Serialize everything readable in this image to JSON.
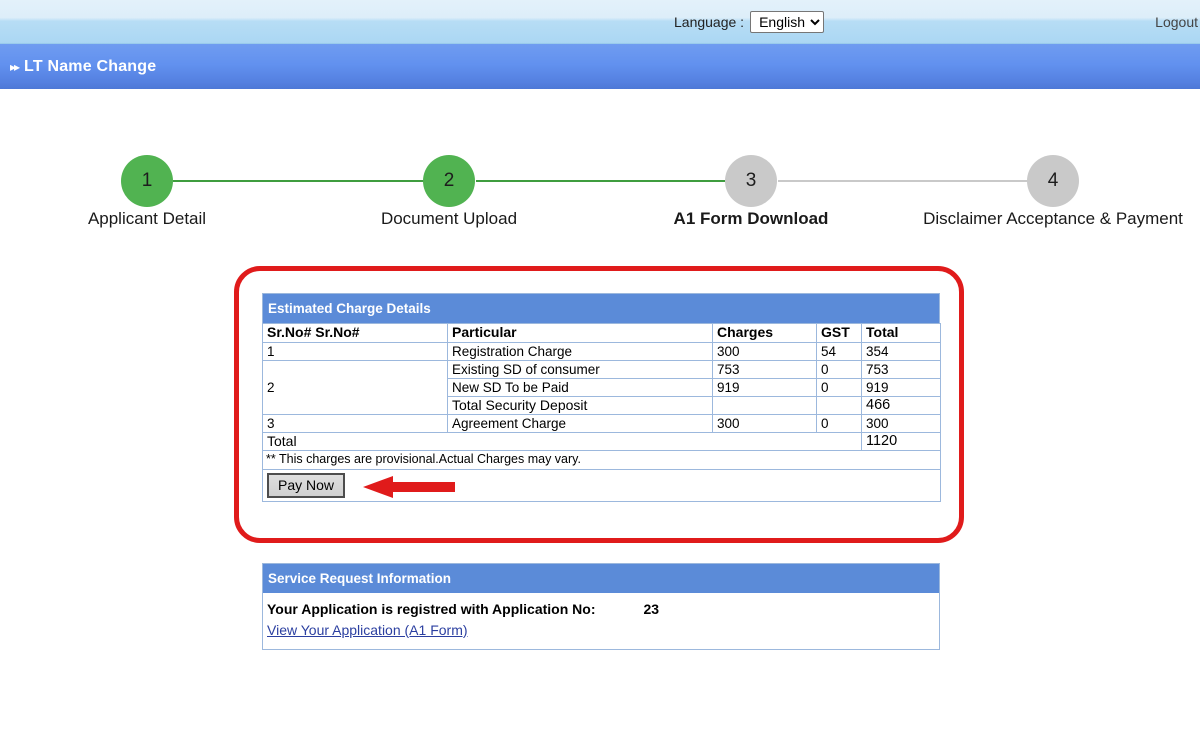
{
  "topbar": {
    "language_label": "Language :",
    "language_value": "English",
    "language_options": [
      "English"
    ],
    "logout_label": "Logout"
  },
  "header": {
    "bullet": "▸▸",
    "title": "LT Name Change"
  },
  "stepper": {
    "steps": [
      {
        "number": "1",
        "label": "Applicant Detail",
        "state": "done"
      },
      {
        "number": "2",
        "label": "Document Upload",
        "state": "done"
      },
      {
        "number": "3",
        "label": "A1 Form Download",
        "state": "active"
      },
      {
        "number": "4",
        "label": "Disclaimer Acceptance & Payment",
        "state": "todo"
      }
    ]
  },
  "charges_panel": {
    "title": "Estimated Charge Details",
    "columns": [
      "Sr.No# Sr.No#",
      "Particular",
      "Charges",
      "GST",
      "Total"
    ],
    "rows": [
      {
        "sr": "1",
        "particular": "Registration Charge",
        "charges": "300",
        "gst": "54",
        "total": "354"
      },
      {
        "sr": "2",
        "particular": "Existing SD of consumer",
        "charges": "753",
        "gst": "0",
        "total": "753"
      },
      {
        "sr": "",
        "particular": "New SD To be Paid",
        "charges": "919",
        "gst": "0",
        "total": "919"
      },
      {
        "sr": "",
        "particular": "Total Security Deposit",
        "charges": "",
        "gst": "",
        "total": "466"
      },
      {
        "sr": "3",
        "particular": "Agreement Charge",
        "charges": "300",
        "gst": "0",
        "total": "300"
      }
    ],
    "total_label": "Total",
    "total_value": "1120",
    "note": "** This charges are provisional.Actual Charges may vary.",
    "pay_button": "Pay Now"
  },
  "service_panel": {
    "title": "Service Request Information",
    "registered_text": "Your Application is registred with Application No:",
    "application_no": "23",
    "view_link": "View Your Application (A1 Form)"
  },
  "colors": {
    "header_blue": "#5b8bd8",
    "step_done_green": "#51b351",
    "step_todo_gray": "#c9c9c9",
    "annotation_red": "#e01b1b",
    "note_red": "#d2575c",
    "link_blue": "#2b3fa0"
  }
}
